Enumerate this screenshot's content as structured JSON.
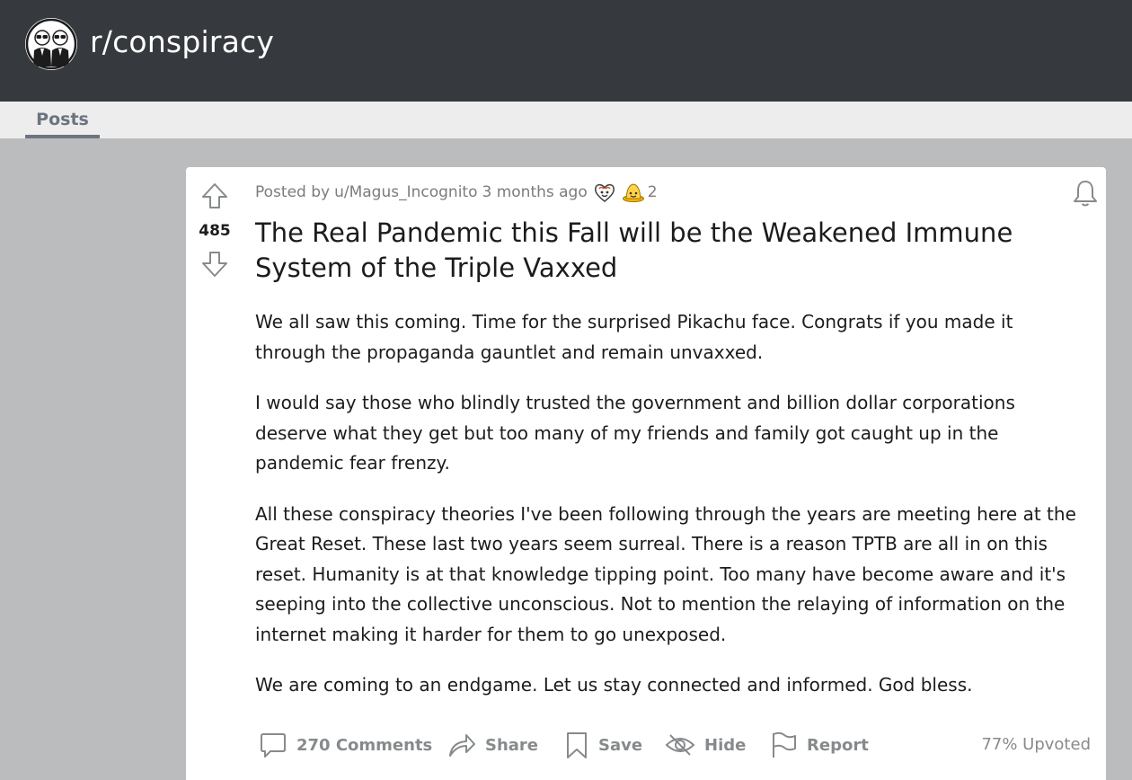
{
  "header": {
    "subreddit_name": "r/conspiracy",
    "avatar_icon": "two-men-in-black-icon"
  },
  "tabs": {
    "posts_label": "Posts"
  },
  "post": {
    "vote_count": "485",
    "posted_by_prefix": "Posted by",
    "author": "u/Magus_Incognito",
    "time_ago": "3 months ago",
    "award_count": "2",
    "title": "The Real Pandemic this Fall will be the Weakened Immune System of the Triple Vaxxed",
    "paragraphs": [
      "We all saw this coming. Time for the surprised Pikachu face. Congrats if you made it through the propaganda gauntlet and remain unvaxxed.",
      "I would say those who blindly trusted the government and billion dollar corporations deserve what they get but too many of my friends and family got caught up in the pandemic fear frenzy.",
      "All these conspiracy theories I've been following through the years are meeting here at the Great Reset. These last two years seem surreal. There is a reason TPTB are all in on this reset. Humanity is at that knowledge tipping point. Too many have become aware and it's seeping into the collective unconscious. Not to mention the relaying of information on the internet making it harder for them to go unexposed.",
      "We are coming to an endgame. Let us stay connected and informed. God bless."
    ],
    "actions": {
      "comments": "270 Comments",
      "share": "Share",
      "save": "Save",
      "hide": "Hide",
      "report": "Report"
    },
    "upvoted": "77% Upvoted"
  },
  "colors": {
    "header_bg": "#363a3e",
    "page_bg": "#bbbcbe",
    "tab_bg": "#ededed",
    "tab_accent": "#6c7480",
    "action_gray": "#878a8c"
  }
}
